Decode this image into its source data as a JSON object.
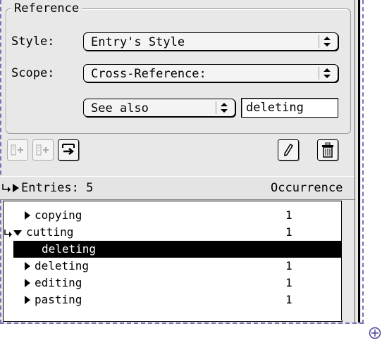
{
  "reference": {
    "group_title": "Reference",
    "style_label": "Style:",
    "style_value": "Entry's Style",
    "scope_label": "Scope:",
    "scope_value": "Cross-Reference:",
    "xref_type_value": "See also",
    "xref_target_value": "deleting"
  },
  "toolbar": {
    "left_icons": [
      "add-entry-icon",
      "add-subentry-icon",
      "cross-reference-icon"
    ],
    "right_icons": [
      "pencil-icon",
      "trash-icon"
    ]
  },
  "entries_header": {
    "label": "Entries: 5",
    "column_occurrence": "Occurrence"
  },
  "entries": [
    {
      "text": "copying",
      "occurrence": "1",
      "expanded": false
    },
    {
      "text": "cutting",
      "occurrence": "1",
      "expanded": true
    },
    {
      "text": "deleting",
      "occurrence": "",
      "selected": true,
      "sub": true
    },
    {
      "text": "deleting",
      "occurrence": "1",
      "expanded": false
    },
    {
      "text": "editing",
      "occurrence": "1",
      "expanded": false
    },
    {
      "text": "pasting",
      "occurrence": "1",
      "expanded": false
    }
  ],
  "colors": {
    "selection": "#000000",
    "dashed_border": "#7773b8",
    "palette_bg": "#e8e8e8"
  }
}
